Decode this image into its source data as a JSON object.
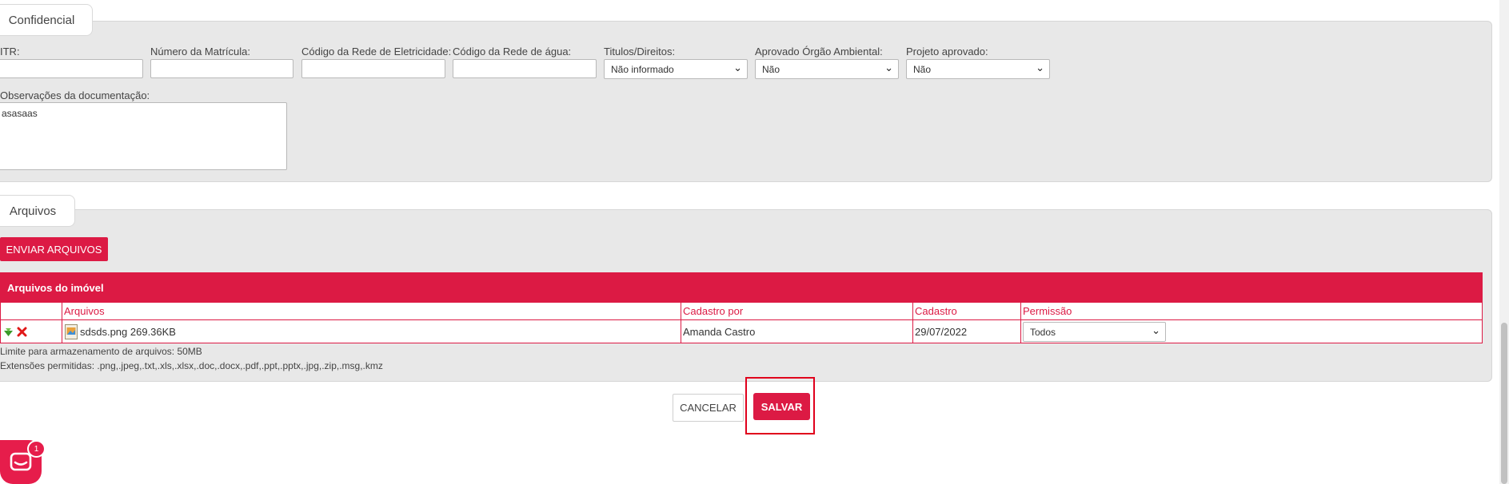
{
  "confidencial": {
    "title": "Confidencial",
    "fields": {
      "itr": {
        "label": "ITR:",
        "value": ""
      },
      "matricula": {
        "label": "Número da Matrícula:",
        "value": ""
      },
      "rede_eletricidade": {
        "label": "Código da Rede de Eletricidade:",
        "value": ""
      },
      "rede_agua": {
        "label": "Código da Rede de água:",
        "value": ""
      },
      "titulos": {
        "label": "Titulos/Direitos:",
        "value": "Não informado"
      },
      "aprovado_ambiental": {
        "label": "Aprovado Órgão Ambiental:",
        "value": "Não"
      },
      "projeto_aprovado": {
        "label": "Projeto aprovado:",
        "value": "Não"
      }
    },
    "observacoes": {
      "label": "Observações da documentação:",
      "value": "asasaas"
    }
  },
  "arquivos": {
    "title": "Arquivos",
    "upload_button": "ENVIAR ARQUIVOS",
    "table": {
      "title": "Arquivos do imóvel",
      "columns": [
        "Arquivos",
        "Cadastro por",
        "Cadastro",
        "Permissão"
      ],
      "rows": [
        {
          "file": "sdsds.png 269.36KB",
          "cadastro_por": "Amanda Castro",
          "cadastro": "29/07/2022",
          "permissao": "Todos"
        }
      ]
    },
    "limit_text": "Limite para armazenamento de arquivos: 50MB",
    "extensions_text": "Extensões permitidas: .png,.jpeg,.txt,.xls,.xlsx,.doc,.docx,.pdf,.ppt,.pptx,.jpg,.zip,.msg,.kmz"
  },
  "actions": {
    "cancel_label": "CANCELAR",
    "save_label": "SALVAR"
  },
  "chat": {
    "badge_count": "1"
  },
  "colors": {
    "accent": "#dc1a44",
    "highlight": "#e0001c",
    "panel_bg": "#e8e8e8"
  }
}
